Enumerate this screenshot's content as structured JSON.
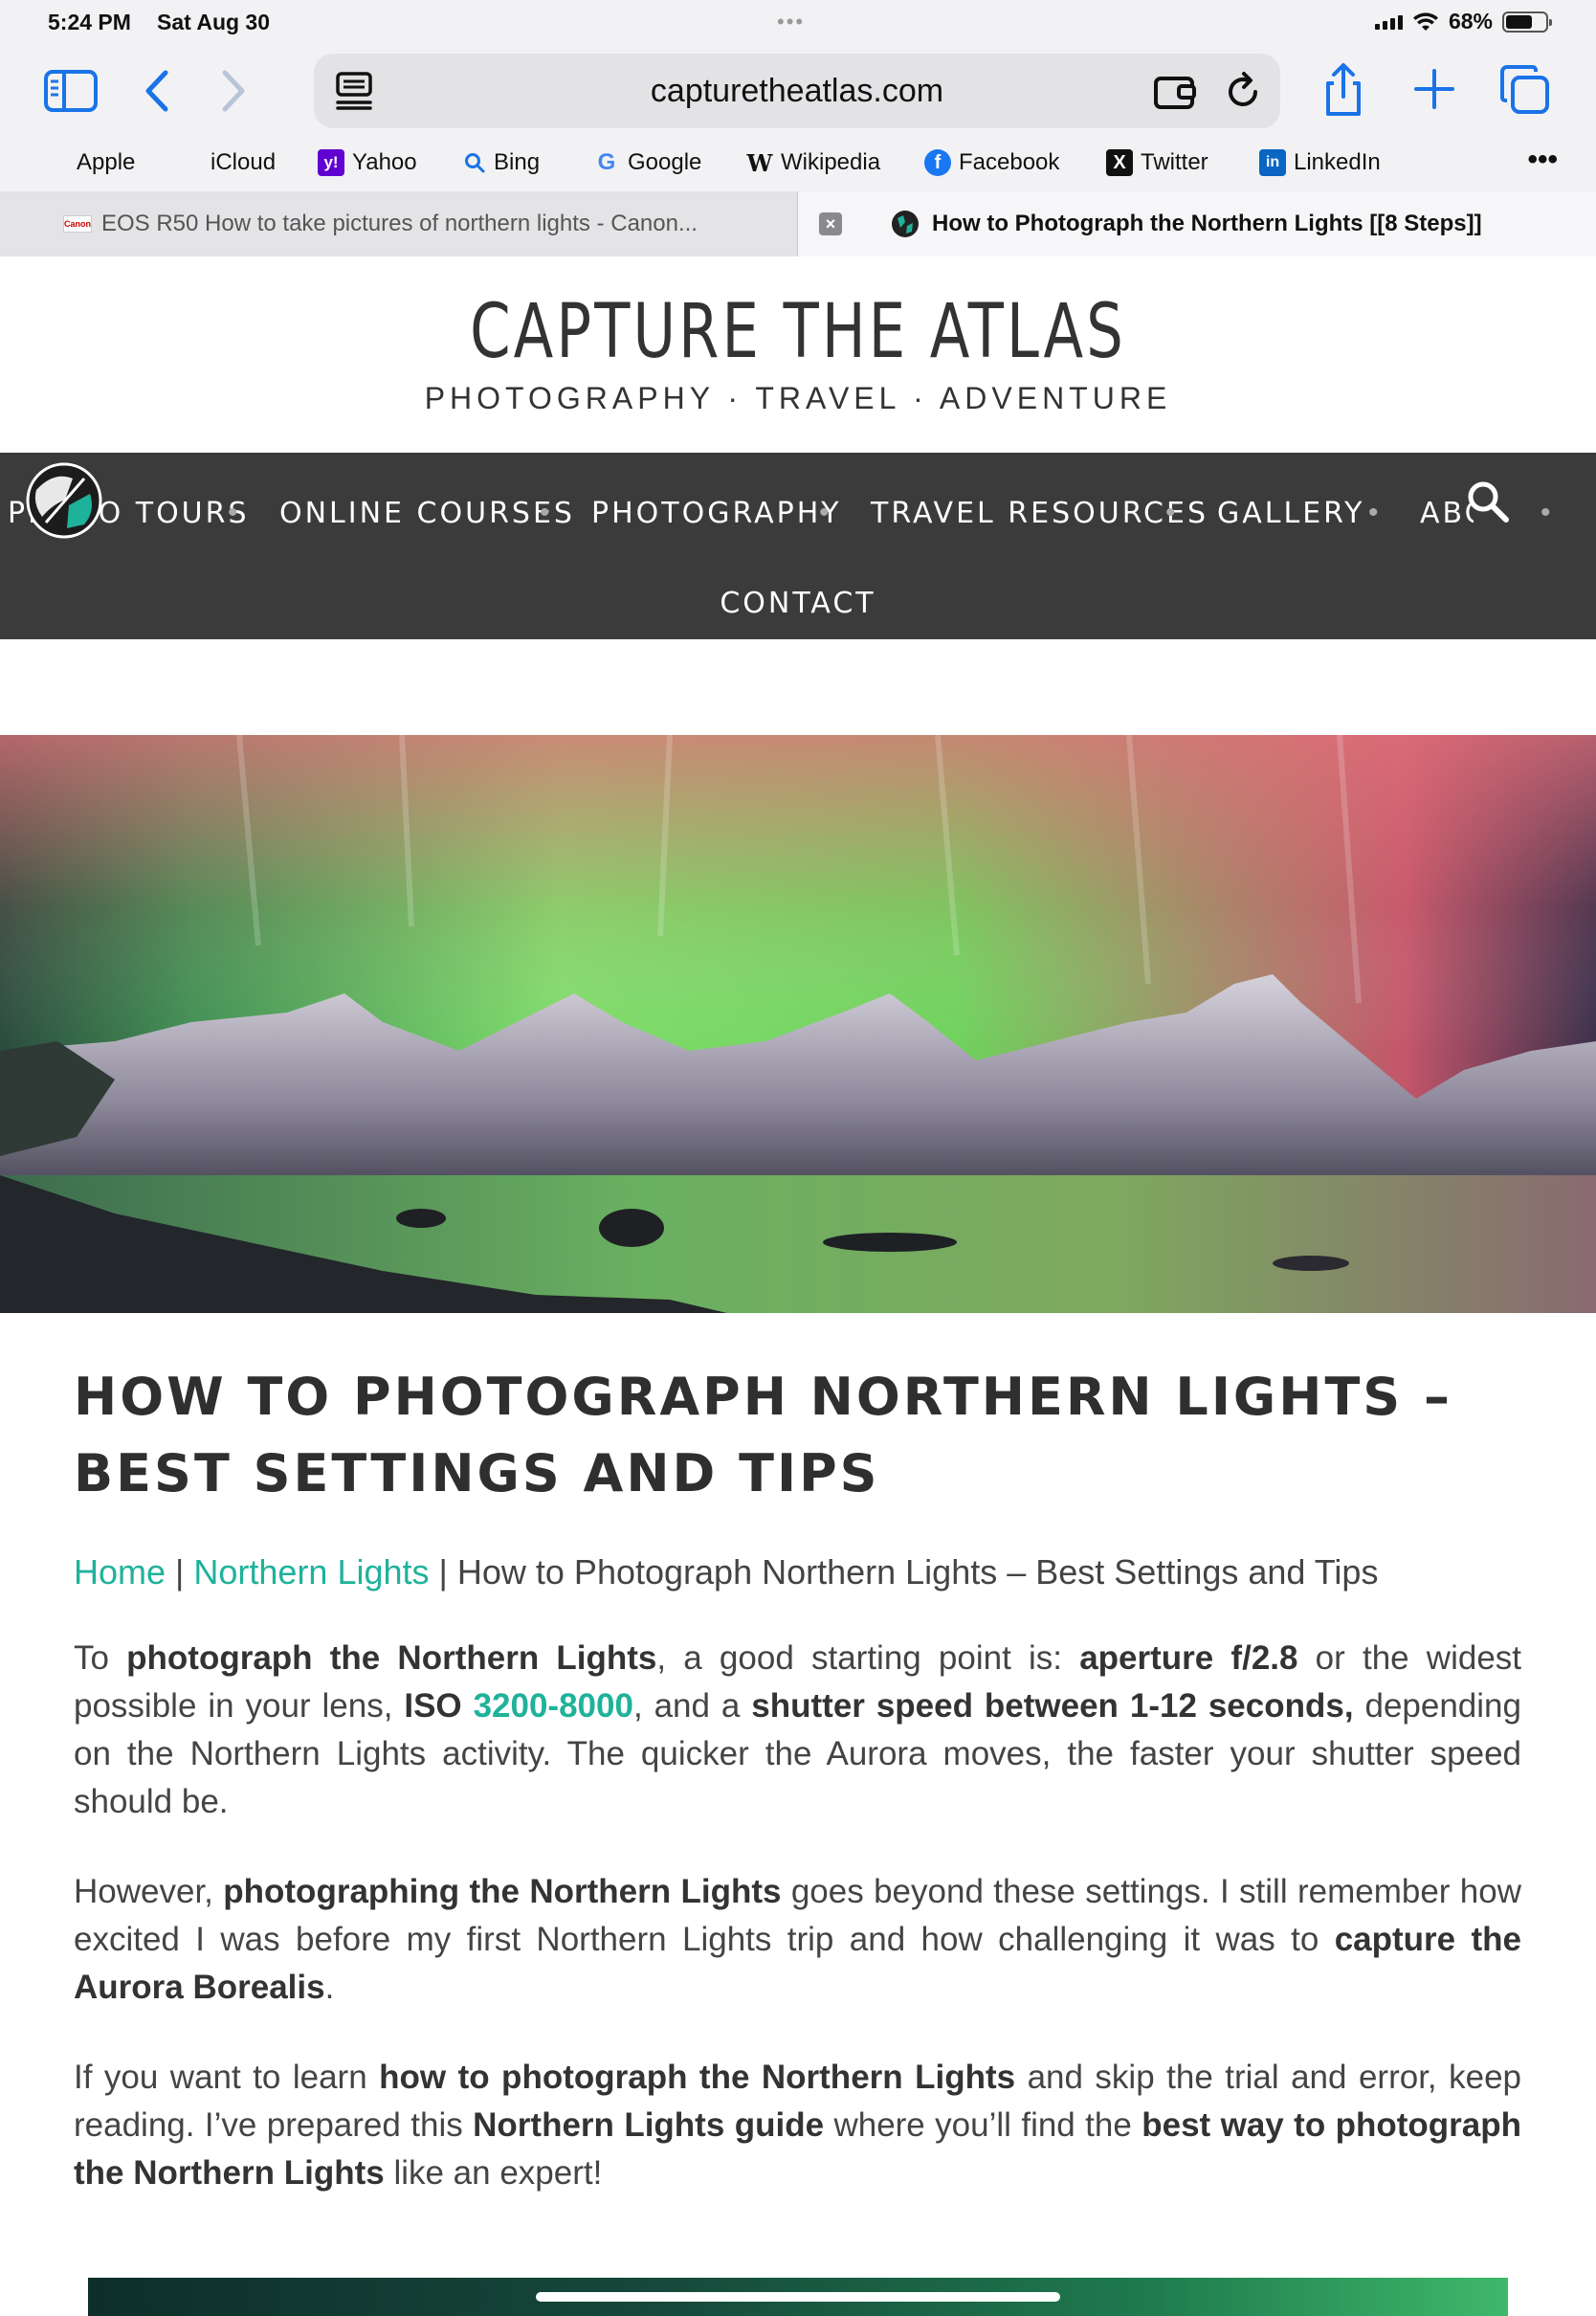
{
  "status": {
    "time": "5:24 PM",
    "date": "Sat Aug 30",
    "battery": "68%",
    "battery_level": 0.68
  },
  "browser": {
    "url": "capturetheatlas.com",
    "favorites": [
      {
        "label": "Apple",
        "icon": "apple-icon"
      },
      {
        "label": "iCloud",
        "icon": "apple-icon"
      },
      {
        "label": "Yahoo",
        "icon": "yahoo-icon"
      },
      {
        "label": "Bing",
        "icon": "bing-icon"
      },
      {
        "label": "Google",
        "icon": "google-icon"
      },
      {
        "label": "Wikipedia",
        "icon": "wikipedia-icon"
      },
      {
        "label": "Facebook",
        "icon": "facebook-icon"
      },
      {
        "label": "Twitter",
        "icon": "x-icon"
      },
      {
        "label": "LinkedIn",
        "icon": "linkedin-icon"
      }
    ],
    "tabs": [
      {
        "title": "EOS R50 How to take pictures of northern lights - Canon...",
        "active": false
      },
      {
        "title": "How to Photograph the Northern Lights [[8 Steps]]",
        "active": true
      }
    ]
  },
  "site": {
    "title": "CAPTURE THE ATLAS",
    "tagline": "PHOTOGRAPHY · TRAVEL · ADVENTURE",
    "nav": [
      "PHOTO TOURS",
      "ONLINE COURSES",
      "PHOTOGRAPHY",
      "TRAVEL RESOURCES",
      "GALLERY",
      "ABOUT"
    ],
    "nav_contact": "CONTACT",
    "separator": "•"
  },
  "article": {
    "title": "HOW TO PHOTOGRAPH NORTHERN LIGHTS – BEST SETTINGS AND TIPS",
    "breadcrumb": {
      "home": "Home",
      "category": "Northern Lights",
      "current": "How to Photograph Northern Lights – Best Settings and Tips",
      "sep": "|"
    },
    "p1": [
      {
        "t": "To "
      },
      {
        "t": "photograph the Northern Lights",
        "s": "b"
      },
      {
        "t": ", a good starting point is: "
      },
      {
        "t": "aperture f/2.8",
        "s": "b"
      },
      {
        "t": " or the widest possible in your lens, "
      },
      {
        "t": "ISO ",
        "s": "b"
      },
      {
        "t": "3200-8000",
        "s": "teal"
      },
      {
        "t": ", and a "
      },
      {
        "t": "shutter speed between 1-12 seconds,",
        "s": "b"
      },
      {
        "t": " depending on the Northern Lights activity. The quicker the Aurora moves, the faster your shutter speed should be."
      }
    ],
    "p2": [
      {
        "t": "However, "
      },
      {
        "t": "photographing the Northern Lights",
        "s": "b"
      },
      {
        "t": " goes beyond these settings. I still remember how excited I was before my first Northern Lights trip and how challenging it was to "
      },
      {
        "t": "capture the Aurora Borealis",
        "s": "b"
      },
      {
        "t": "."
      }
    ],
    "p3": [
      {
        "t": "If you want to learn "
      },
      {
        "t": "how to photograph the Northern Lights",
        "s": "b"
      },
      {
        "t": " and skip the trial and error, keep reading. I’ve prepared this "
      },
      {
        "t": "Northern Lights guide",
        "s": "b"
      },
      {
        "t": " where you’ll find the "
      },
      {
        "t": "best way to photograph the Northern Lights",
        "s": "b"
      },
      {
        "t": " like an expert!"
      }
    ]
  },
  "colors": {
    "accent": "#1fb29a",
    "nav_bg": "#3b3b3b",
    "browser_blue": "#1a73e8"
  }
}
